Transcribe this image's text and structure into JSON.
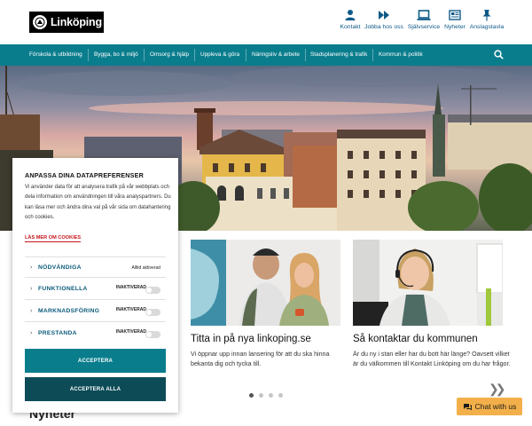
{
  "header": {
    "logo_text": "Linköping",
    "quick_links": [
      {
        "label": "Kontakt",
        "icon": "person-icon"
      },
      {
        "label": "Jobba hos oss",
        "icon": "fast-forward-icon"
      },
      {
        "label": "Självservice",
        "icon": "laptop-icon"
      },
      {
        "label": "Nyheter",
        "icon": "newspaper-icon"
      },
      {
        "label": "Anslagstavla",
        "icon": "pin-icon"
      }
    ]
  },
  "nav": {
    "items": [
      "Förskola & utbildning",
      "Bygga, bo & miljö",
      "Omsorg & hjälp",
      "Uppleva & göra",
      "Näringsliv & arbete",
      "Stadsplanering & trafik",
      "Kommun & politik"
    ],
    "search_icon": "search-icon"
  },
  "cards": [
    {
      "title": "Titta in på nya linkoping.se",
      "text": "Vi öppnar upp innan lansering för att du ska hinna bekanta dig och tycka till."
    },
    {
      "title": "Så kontaktar du kommunen",
      "text": "Är du ny i stan eller har du bott här länge? Oavsett vilket är du välkommen till Kontakt Linköping om du har frågor."
    }
  ],
  "carousel": {
    "dot_count": 4,
    "active_index": 0
  },
  "chat": {
    "label": "Chat with us"
  },
  "news_heading": "Nyheter",
  "cookie": {
    "title": "ANPASSA DINA DATAPREFERENSER",
    "text": "Vi använder data för att analysera trafik på vår webbplats och dela information om användningen till våra analyspartners. Du kan läsa mer och ändra dina val på vår sida om datahantering och cookies.",
    "read_more": "LÄS MER OM COOKIES",
    "categories": [
      {
        "label": "NÖDVÄNDIGA",
        "state": "Alltid aktiverad"
      },
      {
        "label": "FUNKTIONELLA",
        "state": "INAKTIVERAD"
      },
      {
        "label": "MARKNADSFÖRING",
        "state": "INAKTIVERAD"
      },
      {
        "label": "PRESTANDA",
        "state": "INAKTIVERAD"
      }
    ],
    "accept_label": "ACCEPTERA",
    "accept_all_label": "ACCEPTERA ALLA"
  },
  "colors": {
    "nav": "#0a7d8d",
    "accept": "#0a7d8d",
    "accept_all": "#0d4b57",
    "link_red": "#c4151c",
    "chat": "#f3b04a"
  }
}
